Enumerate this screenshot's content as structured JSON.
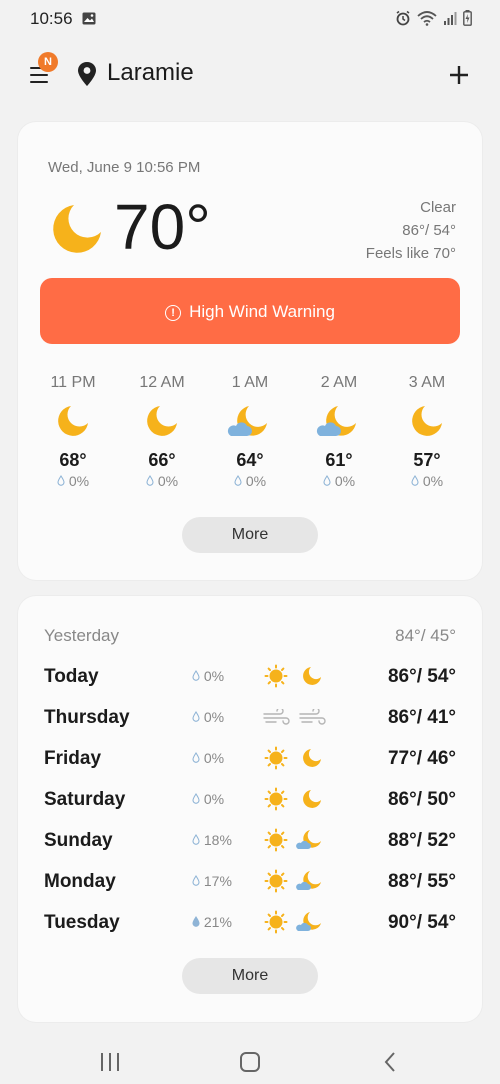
{
  "status_bar": {
    "time": "10:56"
  },
  "header": {
    "city": "Laramie",
    "menu_badge": "N"
  },
  "current": {
    "datetime": "Wed, June 9 10:56 PM",
    "temperature": "70°",
    "condition": "Clear",
    "high_low": "86°/ 54°",
    "feels_like": "Feels like 70°",
    "warning": "High Wind Warning"
  },
  "hourly": [
    {
      "time": "11 PM",
      "icon": "moon-icon",
      "temp": "68°",
      "precip": "0%"
    },
    {
      "time": "12 AM",
      "icon": "moon-icon",
      "temp": "66°",
      "precip": "0%"
    },
    {
      "time": "1 AM",
      "icon": "partly-cloudy-night-icon",
      "temp": "64°",
      "precip": "0%"
    },
    {
      "time": "2 AM",
      "icon": "partly-cloudy-night-icon",
      "temp": "61°",
      "precip": "0%"
    },
    {
      "time": "3 AM",
      "icon": "moon-icon",
      "temp": "57°",
      "precip": "0%"
    }
  ],
  "hourly_more": "More",
  "yesterday": {
    "label": "Yesterday",
    "high_low": "84°/ 45°"
  },
  "daily": [
    {
      "day": "Today",
      "precip": "0%",
      "day_icon": "sun-icon",
      "night_icon": "moon-icon",
      "high_low": "86°/ 54°"
    },
    {
      "day": "Thursday",
      "precip": "0%",
      "day_icon": "wind-icon",
      "night_icon": "wind-icon",
      "high_low": "86°/ 41°"
    },
    {
      "day": "Friday",
      "precip": "0%",
      "day_icon": "sun-icon",
      "night_icon": "moon-icon",
      "high_low": "77°/ 46°"
    },
    {
      "day": "Saturday",
      "precip": "0%",
      "day_icon": "sun-icon",
      "night_icon": "moon-icon",
      "high_low": "86°/ 50°"
    },
    {
      "day": "Sunday",
      "precip": "18%",
      "day_icon": "sun-icon",
      "night_icon": "partly-cloudy-night-icon",
      "high_low": "88°/ 52°"
    },
    {
      "day": "Monday",
      "precip": "17%",
      "day_icon": "sun-icon",
      "night_icon": "partly-cloudy-night-icon",
      "high_low": "88°/ 55°"
    },
    {
      "day": "Tuesday",
      "precip": "21%",
      "day_icon": "sun-icon",
      "night_icon": "partly-cloudy-night-icon",
      "high_low": "90°/ 54°"
    }
  ],
  "daily_more": "More",
  "colors": {
    "warning_bg": "#ff6c45",
    "badge": "#f07a2a",
    "moon": "#f6b21b",
    "sun": "#f6b21b",
    "cloud": "#7fb2dd"
  }
}
